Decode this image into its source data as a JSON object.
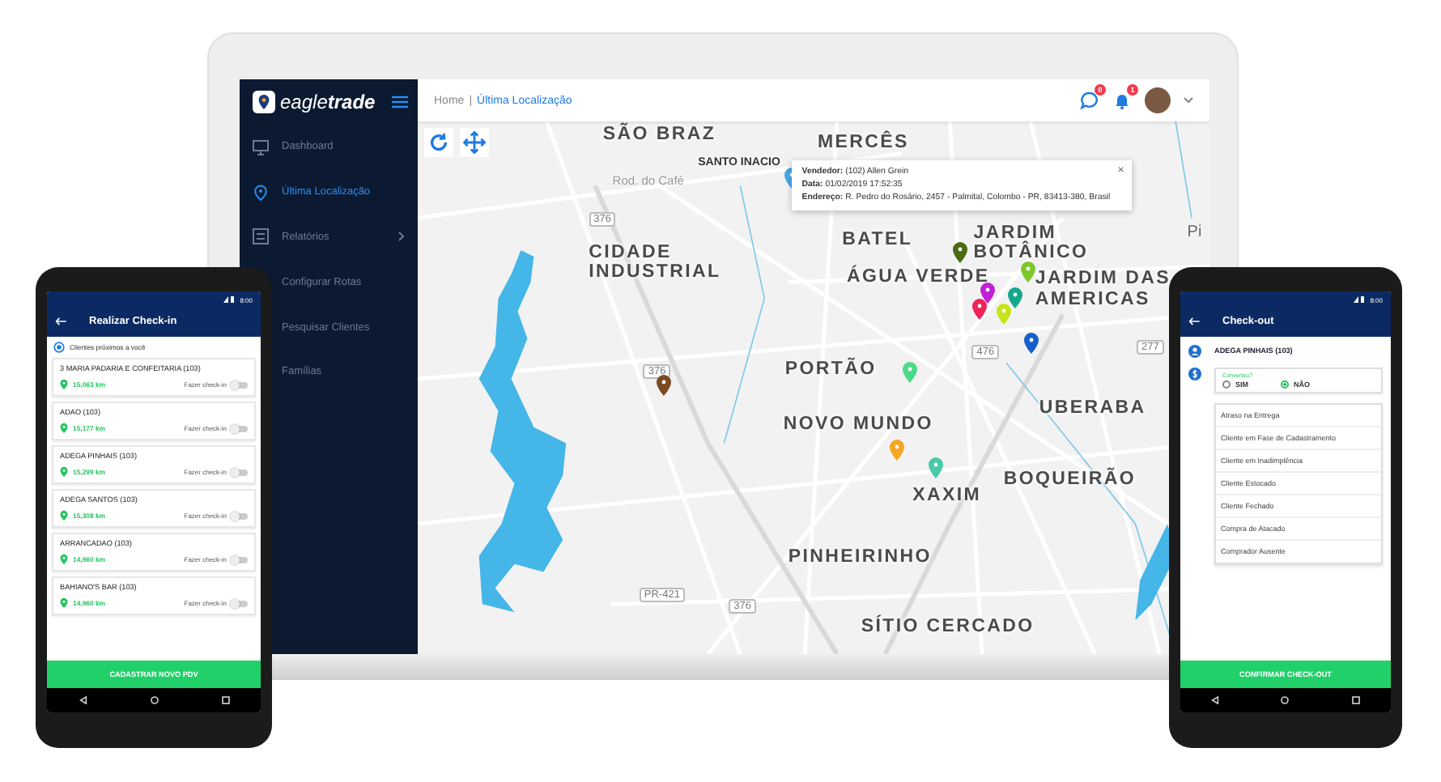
{
  "dashboard": {
    "logo": "eagle**trade**",
    "sidebar": {
      "items": [
        {
          "label": "Dashboard",
          "selected": false
        },
        {
          "label": "Última Localização",
          "selected": true
        },
        {
          "label": "Relatórios",
          "selected": false
        },
        {
          "label": "Configurar Rotas",
          "selected": false
        },
        {
          "label": "Pesquisar Clientes",
          "selected": false
        },
        {
          "label": "Famílias",
          "selected": false
        }
      ]
    },
    "breadcrumb": {
      "home": "Home",
      "separator": "|",
      "current": "Última Localização"
    },
    "header_badges": [
      {
        "kind": "chat",
        "count": "0"
      },
      {
        "kind": "bell",
        "count": "1"
      }
    ],
    "map": {
      "labels": [
        {
          "text": "SÃO BRAZ",
          "kind": "district"
        },
        {
          "text": "MERCÊS",
          "kind": "district"
        },
        {
          "text": "SANTO INACIO",
          "kind": "small"
        },
        {
          "text": "Rod. do Café",
          "kind": "road"
        },
        {
          "text": "BATEL",
          "kind": "district"
        },
        {
          "text": "JARDIM BOTÂNICO",
          "kind": "district-stacked"
        },
        {
          "text": "CIDADE INDUSTRIAL",
          "kind": "district-stacked"
        },
        {
          "text": "ÁGUA VERDE",
          "kind": "district"
        },
        {
          "text": "JARDIM DAS AMERICAS",
          "kind": "district-stacked"
        },
        {
          "text": "PORTÃO",
          "kind": "district"
        },
        {
          "text": "NOVO MUNDO",
          "kind": "district"
        },
        {
          "text": "UBERABA",
          "kind": "district"
        },
        {
          "text": "XAXIM",
          "kind": "district"
        },
        {
          "text": "BOQUEIRÃO",
          "kind": "district"
        },
        {
          "text": "PINHEIRINHO",
          "kind": "district"
        },
        {
          "text": "SÍTIO CERCADO",
          "kind": "district"
        },
        {
          "text": "Pi",
          "kind": "town"
        }
      ],
      "road_shields": [
        "376",
        "376",
        "476",
        "277",
        "PR-421",
        "376"
      ],
      "pins": [
        {
          "color": "#45a8e6"
        },
        {
          "color": "#4a6a14"
        },
        {
          "color": "#c21fd6"
        },
        {
          "color": "#ef2459"
        },
        {
          "color": "#17a88c"
        },
        {
          "color": "#c6e31a"
        },
        {
          "color": "#7dc82d"
        },
        {
          "color": "#1560c8"
        },
        {
          "color": "#7a4a22"
        },
        {
          "color": "#4cd98a"
        },
        {
          "color": "#f5a623"
        },
        {
          "color": "#4ac9a8"
        }
      ],
      "popup": {
        "lines": [
          {
            "label": "Vendedor:",
            "value": "(102) Allen Grein"
          },
          {
            "label": "Data:",
            "value": "01/02/2019   17:52:35"
          },
          {
            "label": "Endereço:",
            "value": "R. Pedro do Rosário, 2457 - Palmital, Colombo - PR, 83413-380, Brasil"
          }
        ],
        "close": "×"
      }
    }
  },
  "checkin_phone": {
    "time": "8:00",
    "title": "Realizar Check-in",
    "nearby": "Clientes próximos a você",
    "clients": [
      {
        "name": "3 MARIA PADARIA E CONFEITARIA (103)",
        "distance": "15,063 km",
        "action": "Fazer check-in",
        "on": false
      },
      {
        "name": "ADAO (103)",
        "distance": "15,177 km",
        "action": "Fazer check-in",
        "on": false
      },
      {
        "name": "ADEGA PINHAIS (103)",
        "distance": "15,299 km",
        "action": "Fazer check-in",
        "on": false
      },
      {
        "name": "ADEGA SANTOS (103)",
        "distance": "15,308 km",
        "action": "Fazer check-in",
        "on": false
      },
      {
        "name": "ARRANCADAO (103)",
        "distance": "14,960 km",
        "action": "Fazer check-in",
        "on": false
      },
      {
        "name": "BAHIANO'S BAR (103)",
        "distance": "14,960 km",
        "action": "Fazer check-in",
        "on": false
      }
    ],
    "button": "CADASTRAR NOVO PDV"
  },
  "checkout_phone": {
    "time": "8:00",
    "title": "Check-out",
    "client": "ADEGA PINHAIS (103)",
    "question": "Converteu?",
    "options": [
      {
        "label": "SIM",
        "selected": false
      },
      {
        "label": "NÃO",
        "selected": true
      }
    ],
    "reasons": [
      "Atraso na Entrega",
      "Cliente em Fase de Cadastramento",
      "Cliente em Inadimplência",
      "Cliente Estocado",
      "Cliente Fechado",
      "Compra de Atacado",
      "Comprador Ausente"
    ],
    "button": "CONFIRMAR CHECK-OUT"
  }
}
